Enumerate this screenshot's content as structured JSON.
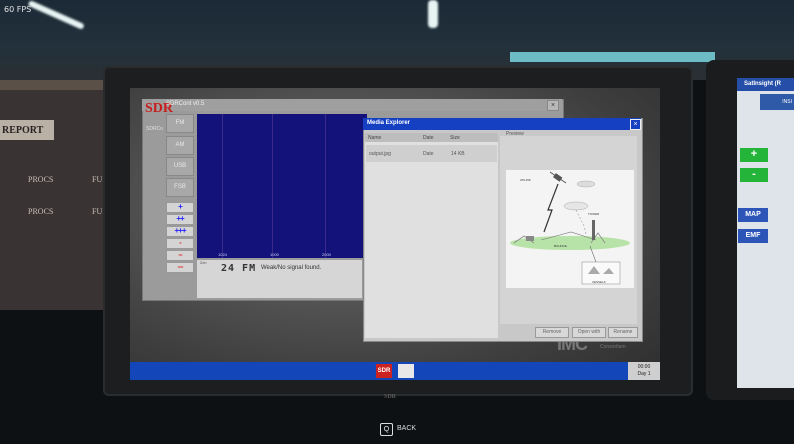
{
  "hud": {
    "fps": "60 FPS",
    "back_key": "Q",
    "back_label": "BACK"
  },
  "room": {
    "report_label": "REPORT",
    "cells": [
      "PROCS",
      "FU",
      "PROCS",
      "FU"
    ],
    "monitor_brand": "SDR"
  },
  "sdr_window": {
    "title": "SDRCont v0.5",
    "logo": "SDR",
    "logo_sub": "SDRCo",
    "close": "×",
    "modes": [
      "FM",
      "AM",
      "USB",
      "FSB"
    ],
    "steps_up": [
      "+",
      "++",
      "+++"
    ],
    "steps_down": [
      "-",
      "--",
      "---"
    ],
    "x_ticks": [
      "1024",
      "1000",
      "2000"
    ],
    "frequency_label": "2ch",
    "frequency": "24 FM",
    "signal_status": "Weak/No signal found."
  },
  "media_explorer": {
    "title": "Media Explorer",
    "close": "×",
    "columns": [
      "Name",
      "Date",
      "Size"
    ],
    "files": [
      {
        "name": "output.jpg",
        "date": "Date",
        "size": "14 KB"
      }
    ],
    "preview_label": "Preview",
    "diagram": {
      "uplink": "UPLINK",
      "tower": "TOWER",
      "vessels": "VESSELS",
      "bounce": "BOUNCE"
    },
    "buttons": {
      "remove": "Remove",
      "open_with": "Open with",
      "rename": "Rename"
    }
  },
  "taskbar": {
    "sdr_app": "SDR",
    "clock_time": "00:00",
    "clock_day": "Day 1",
    "imc": "IMC",
    "imc_sub_1": "Maritime",
    "imc_sub_2": "Consortium"
  },
  "right_monitor": {
    "title": "SatInsight (R",
    "logo": "INSI",
    "plus": "+",
    "minus": "-",
    "map": "MAP",
    "emf": "EMF"
  },
  "colors": {
    "taskbar": "#1346b8",
    "titlebar": "#1540c2",
    "spectrum": "#12127a",
    "step_plus": "#2323ff",
    "step_minus": "#e23232",
    "sat_green": "#24b43a"
  }
}
